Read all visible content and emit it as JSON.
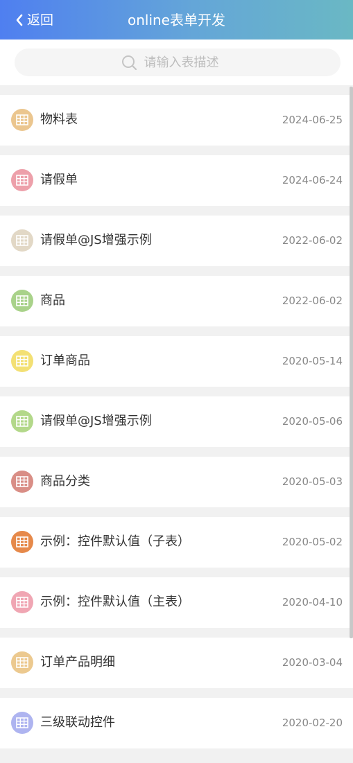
{
  "header": {
    "back_label": "返回",
    "title": "online表单开发",
    "gradient": [
      "#4f7ff0",
      "#6ab8c4"
    ]
  },
  "search": {
    "placeholder": "请输入表描述",
    "value": ""
  },
  "items": [
    {
      "name": "物料表",
      "date": "2024-06-25",
      "color": "#ebc68f"
    },
    {
      "name": "请假单",
      "date": "2024-06-24",
      "color": "#eda0aa"
    },
    {
      "name": "请假单@JS增强示例",
      "date": "2022-06-02",
      "color": "#e2d8c6"
    },
    {
      "name": "商品",
      "date": "2022-06-02",
      "color": "#a9d28a"
    },
    {
      "name": "订单商品",
      "date": "2020-05-14",
      "color": "#f3e074"
    },
    {
      "name": "请假单@JS增强示例",
      "date": "2020-05-06",
      "color": "#b3d88a"
    },
    {
      "name": "商品分类",
      "date": "2020-05-03",
      "color": "#d98e86"
    },
    {
      "name": "示例：控件默认值（子表）",
      "date": "2020-05-02",
      "color": "#e6894a"
    },
    {
      "name": "示例：控件默认值（主表）",
      "date": "2020-04-10",
      "color": "#f0a6b3"
    },
    {
      "name": "订单产品明细",
      "date": "2020-03-04",
      "color": "#ecc98f"
    },
    {
      "name": "三级联动控件",
      "date": "2020-02-20",
      "color": "#aeb4f0"
    }
  ]
}
